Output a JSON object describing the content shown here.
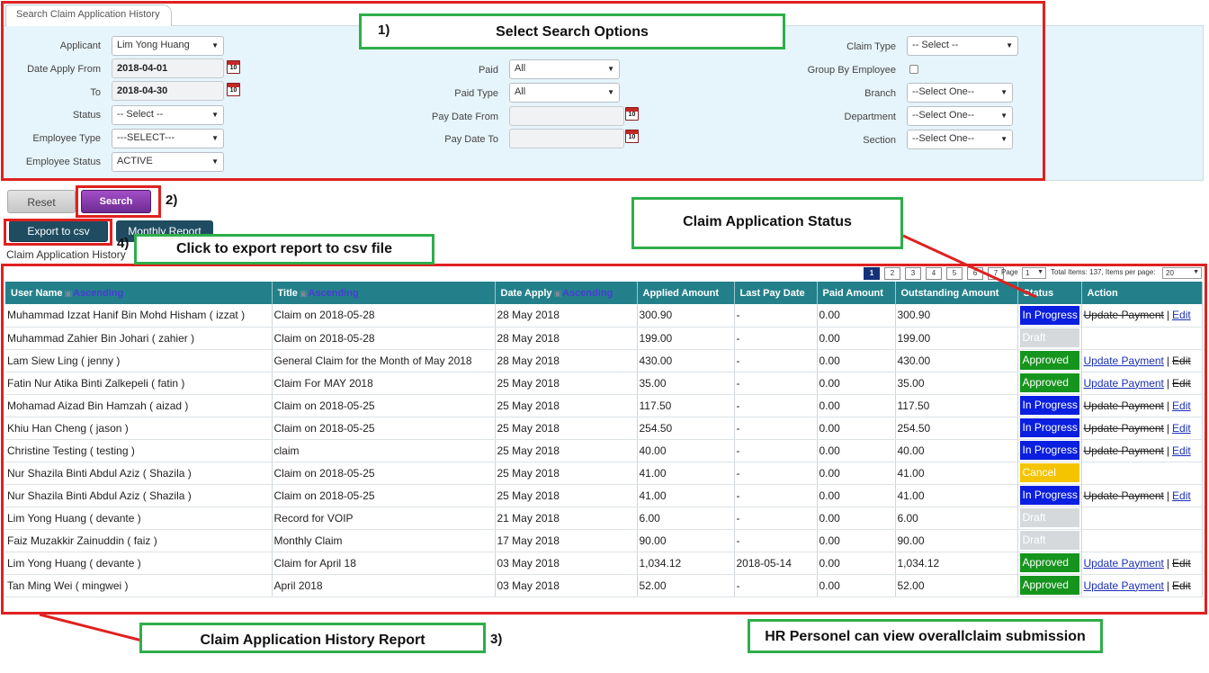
{
  "panel": {
    "tab_title": "Search Claim Application History",
    "col1": {
      "applicant_label": "Applicant",
      "applicant_value": "Lim Yong Huang",
      "date_from_label": "Date Apply From",
      "date_from_value": "2018-04-01",
      "to_label": "To",
      "to_value": "2018-04-30",
      "status_label": "Status",
      "status_value": "-- Select --",
      "employee_type_label": "Employee Type",
      "employee_type_value": "---SELECT---",
      "employee_status_label": "Employee Status",
      "employee_status_value": "ACTIVE"
    },
    "col2": {
      "paid_label": "Paid",
      "paid_value": "All",
      "paid_type_label": "Paid Type",
      "paid_type_value": "All",
      "pay_date_from_label": "Pay Date From",
      "pay_date_to_label": "Pay Date To"
    },
    "col3": {
      "claim_type_label": "Claim Type",
      "claim_type_value": "-- Select --",
      "group_by_label": "Group By Employee",
      "branch_label": "Branch",
      "branch_value": "--Select One--",
      "department_label": "Department",
      "department_value": "--Select One--",
      "section_label": "Section",
      "section_value": "--Select One--"
    },
    "calendar_glyph": "10"
  },
  "buttons": {
    "reset": "Reset",
    "search": "Search",
    "export": "Export to csv",
    "monthly": "Monthly Report"
  },
  "history_label": "Claim Application History",
  "pagination": {
    "pages": [
      "1",
      "2",
      "3",
      "4",
      "5",
      "6",
      "7"
    ],
    "current": "1",
    "page_label": "Page",
    "page_value": "1",
    "total_text": "Total Items: 137, Items per page:",
    "per_page_value": "20"
  },
  "table": {
    "headers": {
      "user_name": "User Name",
      "title": "Title",
      "date_apply": "Date Apply",
      "applied_amount": "Applied Amount",
      "last_pay_date": "Last Pay Date",
      "paid_amount": "Paid Amount",
      "outstanding_amount": "Outstanding Amount",
      "status": "Status",
      "action": "Action",
      "sort_alt": "Ascending"
    },
    "action_text": {
      "update": "Update Payment",
      "sep": "|",
      "edit": "Edit"
    },
    "rows": [
      {
        "user": "Muhammad Izzat Hanif Bin Mohd Hisham ( izzat )",
        "title": "Claim on 2018-05-28",
        "date": "28 May 2018",
        "applied": "300.90",
        "last_pay": "-",
        "paid": "0.00",
        "outstanding": "300.90",
        "status": "In Progress",
        "update_enabled": false,
        "edit_enabled": true
      },
      {
        "user": "Muhammad Zahier Bin Johari ( zahier )",
        "title": "Claim on 2018-05-28",
        "date": "28 May 2018",
        "applied": "199.00",
        "last_pay": "-",
        "paid": "0.00",
        "outstanding": "199.00",
        "status": "Draft",
        "update_enabled": null,
        "edit_enabled": null
      },
      {
        "user": "Lam Siew Ling ( jenny )",
        "title": "General Claim for the Month of May 2018",
        "date": "28 May 2018",
        "applied": "430.00",
        "last_pay": "-",
        "paid": "0.00",
        "outstanding": "430.00",
        "status": "Approved",
        "update_enabled": true,
        "edit_enabled": false
      },
      {
        "user": "Fatin Nur Atika Binti Zalkepeli ( fatin )",
        "title": "Claim For MAY 2018",
        "date": "25 May 2018",
        "applied": "35.00",
        "last_pay": "-",
        "paid": "0.00",
        "outstanding": "35.00",
        "status": "Approved",
        "update_enabled": true,
        "edit_enabled": false
      },
      {
        "user": "Mohamad Aizad Bin Hamzah ( aizad )",
        "title": "Claim on 2018-05-25",
        "date": "25 May 2018",
        "applied": "117.50",
        "last_pay": "-",
        "paid": "0.00",
        "outstanding": "117.50",
        "status": "In Progress",
        "update_enabled": false,
        "edit_enabled": true
      },
      {
        "user": "Khiu Han Cheng ( jason )",
        "title": "Claim on 2018-05-25",
        "date": "25 May 2018",
        "applied": "254.50",
        "last_pay": "-",
        "paid": "0.00",
        "outstanding": "254.50",
        "status": "In Progress",
        "update_enabled": false,
        "edit_enabled": true
      },
      {
        "user": "Christine Testing ( testing )",
        "title": "claim",
        "date": "25 May 2018",
        "applied": "40.00",
        "last_pay": "-",
        "paid": "0.00",
        "outstanding": "40.00",
        "status": "In Progress",
        "update_enabled": false,
        "edit_enabled": true
      },
      {
        "user": "Nur Shazila Binti Abdul Aziz ( Shazila )",
        "title": "Claim on 2018-05-25",
        "date": "25 May 2018",
        "applied": "41.00",
        "last_pay": "-",
        "paid": "0.00",
        "outstanding": "41.00",
        "status": "Cancel",
        "update_enabled": null,
        "edit_enabled": null
      },
      {
        "user": "Nur Shazila Binti Abdul Aziz ( Shazila )",
        "title": "Claim on 2018-05-25",
        "date": "25 May 2018",
        "applied": "41.00",
        "last_pay": "-",
        "paid": "0.00",
        "outstanding": "41.00",
        "status": "In Progress",
        "update_enabled": false,
        "edit_enabled": true
      },
      {
        "user": "Lim Yong Huang ( devante )",
        "title": "Record for VOIP",
        "date": "21 May 2018",
        "applied": "6.00",
        "last_pay": "-",
        "paid": "0.00",
        "outstanding": "6.00",
        "status": "Draft",
        "update_enabled": null,
        "edit_enabled": null
      },
      {
        "user": "Faiz Muzakkir Zainuddin ( faiz )",
        "title": "Monthly Claim",
        "date": "17 May 2018",
        "applied": "90.00",
        "last_pay": "-",
        "paid": "0.00",
        "outstanding": "90.00",
        "status": "Draft",
        "update_enabled": null,
        "edit_enabled": null
      },
      {
        "user": "Lim Yong Huang ( devante )",
        "title": "Claim for April 18",
        "date": "03 May 2018",
        "applied": "1,034.12",
        "last_pay": "2018-05-14",
        "paid": "0.00",
        "outstanding": "1,034.12",
        "status": "Approved",
        "update_enabled": true,
        "edit_enabled": false
      },
      {
        "user": "Tan Ming Wei ( mingwei )",
        "title": "April 2018",
        "date": "03 May 2018",
        "applied": "52.00",
        "last_pay": "-",
        "paid": "0.00",
        "outstanding": "52.00",
        "status": "Approved",
        "update_enabled": true,
        "edit_enabled": false
      }
    ]
  },
  "status_colors": {
    "In Progress": "#0a1fe0",
    "Draft": "#d6d9dc",
    "Approved": "#16951e",
    "Cancel": "#f5c400"
  },
  "annotations": {
    "n1": "1)",
    "n2": "2)",
    "n3": "3)",
    "n4": "4)",
    "select_options": "Select Search Options",
    "claim_status": "Claim Application Status",
    "export_hint": "Click to export report to csv file",
    "history_report": "Claim Application History Report",
    "hr_view": "HR Personel can view overallclaim submission",
    "red_color": "#e02020",
    "green_color": "#2eae4a"
  }
}
